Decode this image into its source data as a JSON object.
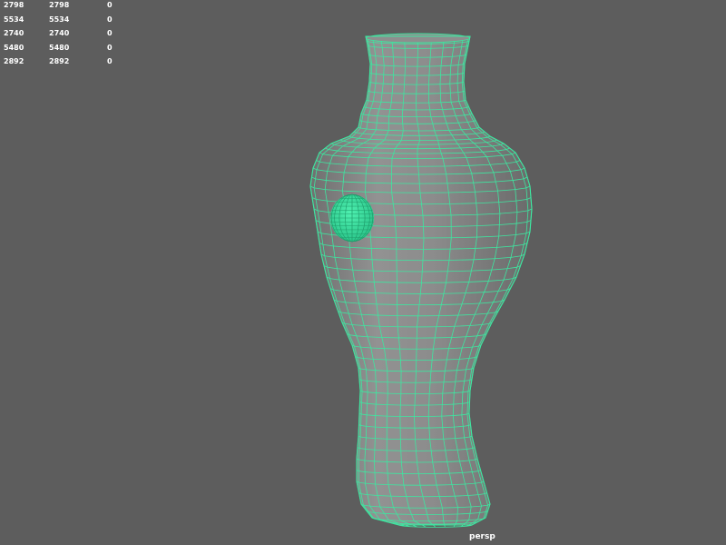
{
  "hud": {
    "rows": [
      {
        "a": "2798",
        "b": "2798",
        "c": "0"
      },
      {
        "a": "5534",
        "b": "5534",
        "c": "0"
      },
      {
        "a": "2740",
        "b": "2740",
        "c": "0"
      },
      {
        "a": "5480",
        "b": "5480",
        "c": "0"
      },
      {
        "a": "2892",
        "b": "2892",
        "c": "0"
      }
    ]
  },
  "camera": {
    "label": "persp"
  },
  "colors": {
    "background": "#5d5d5d",
    "wireframe": "#3ee6a0",
    "mesh_fill": "#8a8a8a",
    "text": "#ffffff"
  }
}
